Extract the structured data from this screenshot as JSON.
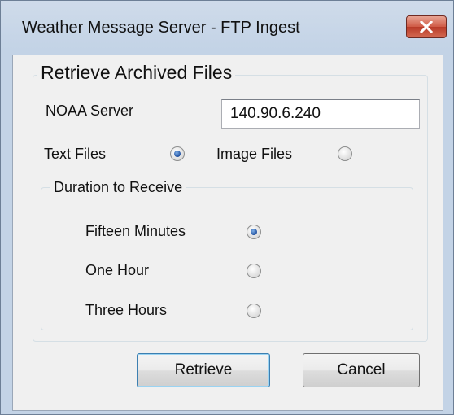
{
  "window": {
    "title": "Weather Message Server - FTP Ingest",
    "close_icon": "close-x-icon"
  },
  "archive_group": {
    "legend": "Retrieve Archived Files",
    "server": {
      "label": "NOAA Server",
      "value": "140.90.6.240"
    },
    "file_type": {
      "options": [
        {
          "label": "Text Files",
          "checked": true
        },
        {
          "label": "Image Files",
          "checked": false
        }
      ]
    },
    "duration": {
      "legend": "Duration to Receive",
      "options": [
        {
          "label": "Fifteen Minutes",
          "checked": true
        },
        {
          "label": "One Hour",
          "checked": false
        },
        {
          "label": "Three Hours",
          "checked": false
        }
      ]
    }
  },
  "buttons": {
    "retrieve": "Retrieve",
    "cancel": "Cancel"
  },
  "colors": {
    "title_bar": "#c3d3e6",
    "client_area": "#f0f0f0",
    "close_button": "#cf5a45",
    "radio_selected": "#1f4f9e"
  }
}
